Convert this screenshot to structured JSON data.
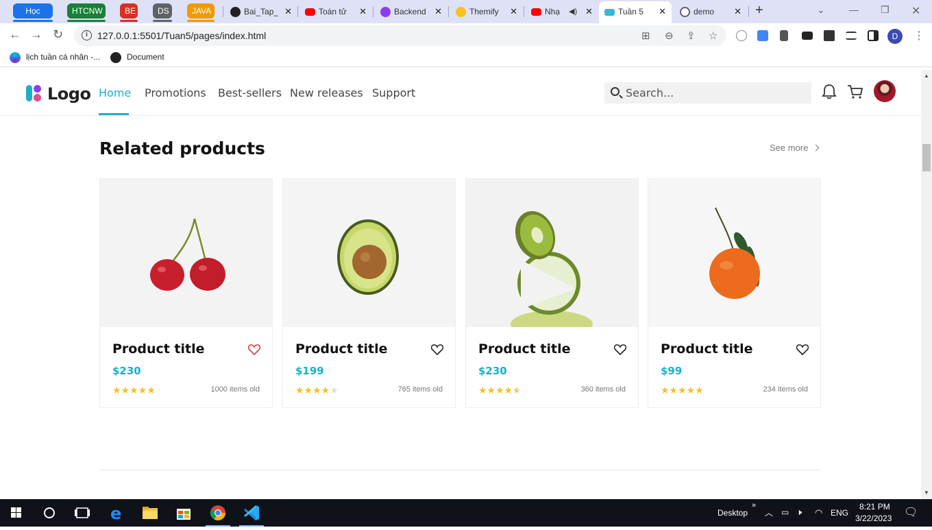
{
  "browser": {
    "tab_groups": [
      {
        "label": "Học Tập",
        "color": "#1a73e8"
      },
      {
        "label": "HTCNW",
        "color": "#188038"
      },
      {
        "label": "BE",
        "color": "#d93025"
      },
      {
        "label": "DS",
        "color": "#5f6368"
      },
      {
        "label": "JAVA",
        "color": "#f29900"
      }
    ],
    "tabs": [
      {
        "title": "Bai_Tap_",
        "icon": "github-icon"
      },
      {
        "title": "Toán tử",
        "icon": "youtube-icon"
      },
      {
        "title": "Backend",
        "icon": "udemy-icon"
      },
      {
        "title": "Themify",
        "icon": "emoji-icon"
      },
      {
        "title": "Nhạ",
        "icon": "youtube-icon"
      },
      {
        "title": "Tuần 5",
        "icon": "page-icon",
        "active": true
      },
      {
        "title": "demo",
        "icon": "globe-icon"
      }
    ],
    "url": "127.0.0.1:5501/Tuan5/pages/index.html",
    "profile_initial": "D",
    "bookmarks": [
      {
        "label": "lịch tuần cá nhân -..."
      },
      {
        "label": "Document"
      }
    ]
  },
  "site": {
    "logo_text": "Logo",
    "nav": [
      {
        "label": "Home",
        "active": true
      },
      {
        "label": "Promotions"
      },
      {
        "label": "Best-sellers"
      },
      {
        "label": "New releases"
      },
      {
        "label": "Support"
      }
    ],
    "search_placeholder": "Search...",
    "accent": "#1ab1c5"
  },
  "section": {
    "title": "Related products",
    "see_more": "See more"
  },
  "products": [
    {
      "title": "Product title",
      "price": "$230",
      "rating": 5,
      "sold": "1000 items old",
      "favorited": true,
      "image": "cherries"
    },
    {
      "title": "Product title",
      "price": "$199",
      "rating": 4,
      "sold": "765 items old",
      "favorited": false,
      "image": "avocado"
    },
    {
      "title": "Product title",
      "price": "$230",
      "rating": 4.5,
      "sold": "360 items old",
      "favorited": false,
      "image": "kiwi-lime"
    },
    {
      "title": "Product title",
      "price": "$99",
      "rating": 5,
      "sold": "234 items old",
      "favorited": false,
      "image": "tangerine"
    }
  ],
  "taskbar": {
    "desktop_label": "Desktop",
    "language": "ENG",
    "time": "8:21 PM",
    "date": "3/22/2023"
  }
}
